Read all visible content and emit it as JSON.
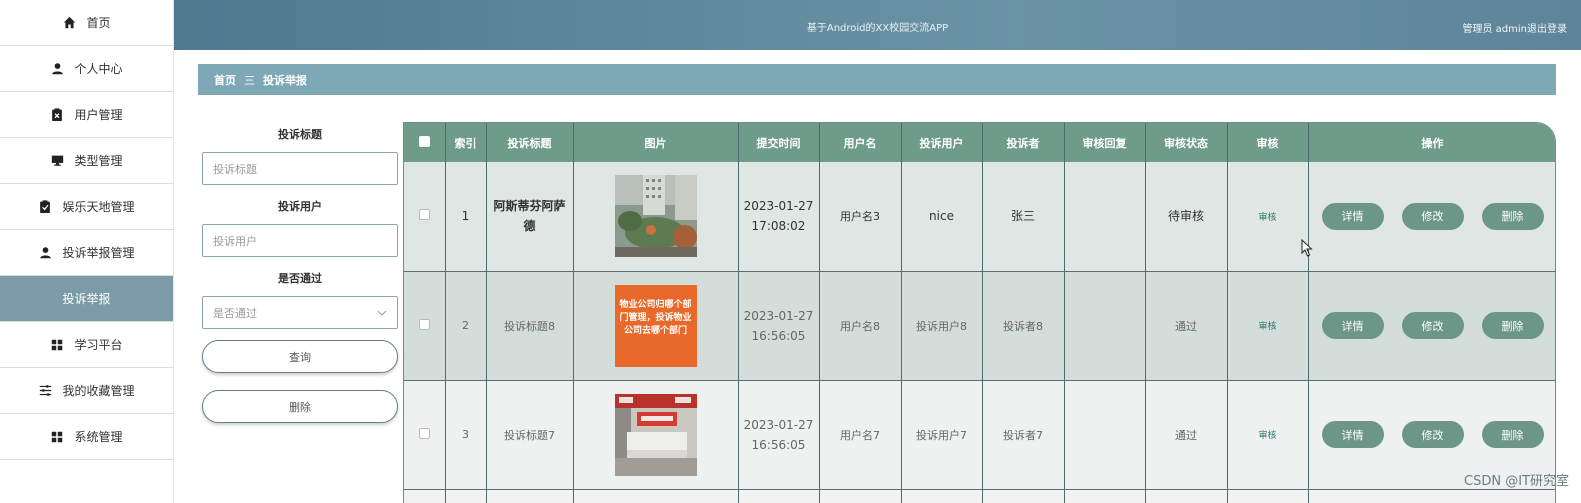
{
  "header": {
    "title": "基于Android的XX校园交流APP",
    "user": "管理员 admin",
    "logout": "退出登录"
  },
  "sidebar": {
    "items": [
      {
        "label": "首页",
        "icon": "home-icon"
      },
      {
        "label": "个人中心",
        "icon": "user-icon"
      },
      {
        "label": "用户管理",
        "icon": "clipboard-x-icon"
      },
      {
        "label": "类型管理",
        "icon": "monitor-icon"
      },
      {
        "label": "娱乐天地管理",
        "icon": "clipboard-check-icon"
      },
      {
        "label": "投诉举报管理",
        "icon": "person-icon"
      },
      {
        "label": "投诉举报",
        "icon": "",
        "active": true
      },
      {
        "label": "学习平台",
        "icon": "grid-icon"
      },
      {
        "label": "我的收藏管理",
        "icon": "sliders-icon"
      },
      {
        "label": "系统管理",
        "icon": "grid-icon"
      }
    ]
  },
  "breadcrumb": {
    "home": "首页",
    "separator": "三",
    "current": "投诉举报"
  },
  "search": {
    "title_label": "投诉标题",
    "title_placeholder": "投诉标题",
    "user_label": "投诉用户",
    "user_placeholder": "投诉用户",
    "pass_label": "是否通过",
    "pass_placeholder": "是否通过",
    "query_button": "查询",
    "delete_button": "删除"
  },
  "table": {
    "headers": [
      "索引",
      "投诉标题",
      "图片",
      "提交时间",
      "用户名",
      "投诉用户",
      "投诉者",
      "审核回复",
      "审核状态",
      "审核",
      "操作"
    ],
    "rows": [
      {
        "index": "1",
        "title": "阿斯蒂芬阿萨德",
        "date": "2023-01-27",
        "time": "17:08:02",
        "username": "用户名3",
        "complaint_user": "nice",
        "complainer": "张三",
        "reply": "",
        "status": "待审核",
        "audit": "审核",
        "image": "building-photo"
      },
      {
        "index": "2",
        "title": "投诉标题8",
        "date": "2023-01-27",
        "time": "16:56:05",
        "username": "用户名8",
        "complaint_user": "投诉用户8",
        "complainer": "投诉者8",
        "reply": "",
        "status": "通过",
        "audit": "审核",
        "image": "orange-text-card",
        "image_text": "物业公司归哪个部门管理，投诉物业公司去哪个部门"
      },
      {
        "index": "3",
        "title": "投诉标题7",
        "date": "2023-01-27",
        "time": "16:56:05",
        "username": "用户名7",
        "complaint_user": "投诉用户7",
        "complainer": "投诉者7",
        "reply": "",
        "status": "通过",
        "audit": "审核",
        "image": "lobby-photo"
      }
    ],
    "ops": {
      "detail": "详情",
      "edit": "修改",
      "delete": "删除"
    }
  },
  "watermark": "CSDN @IT研究室",
  "colors": {
    "header": "#5b8499",
    "accent": "#6c9687",
    "active_sidebar": "#7a9ba7"
  }
}
